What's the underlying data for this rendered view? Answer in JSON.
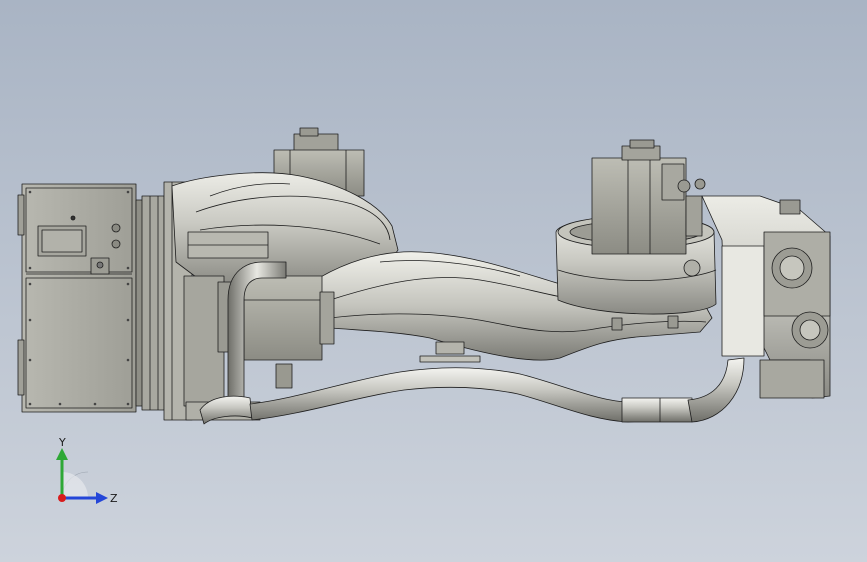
{
  "viewport": {
    "background_top": "#a9b4c4",
    "background_bottom": "#cdd3dc"
  },
  "model": {
    "shade_light": "#e6e6e0",
    "shade_mid": "#b9b9b2",
    "shade_dark": "#7e7e78",
    "edge_color": "#1e1e1e",
    "box_color": "#a4a49c"
  },
  "triad": {
    "y_label": "Y",
    "z_label": "Z",
    "y_color": "#2ea836",
    "z_color": "#2446d8",
    "origin_color": "#d81c1c"
  }
}
